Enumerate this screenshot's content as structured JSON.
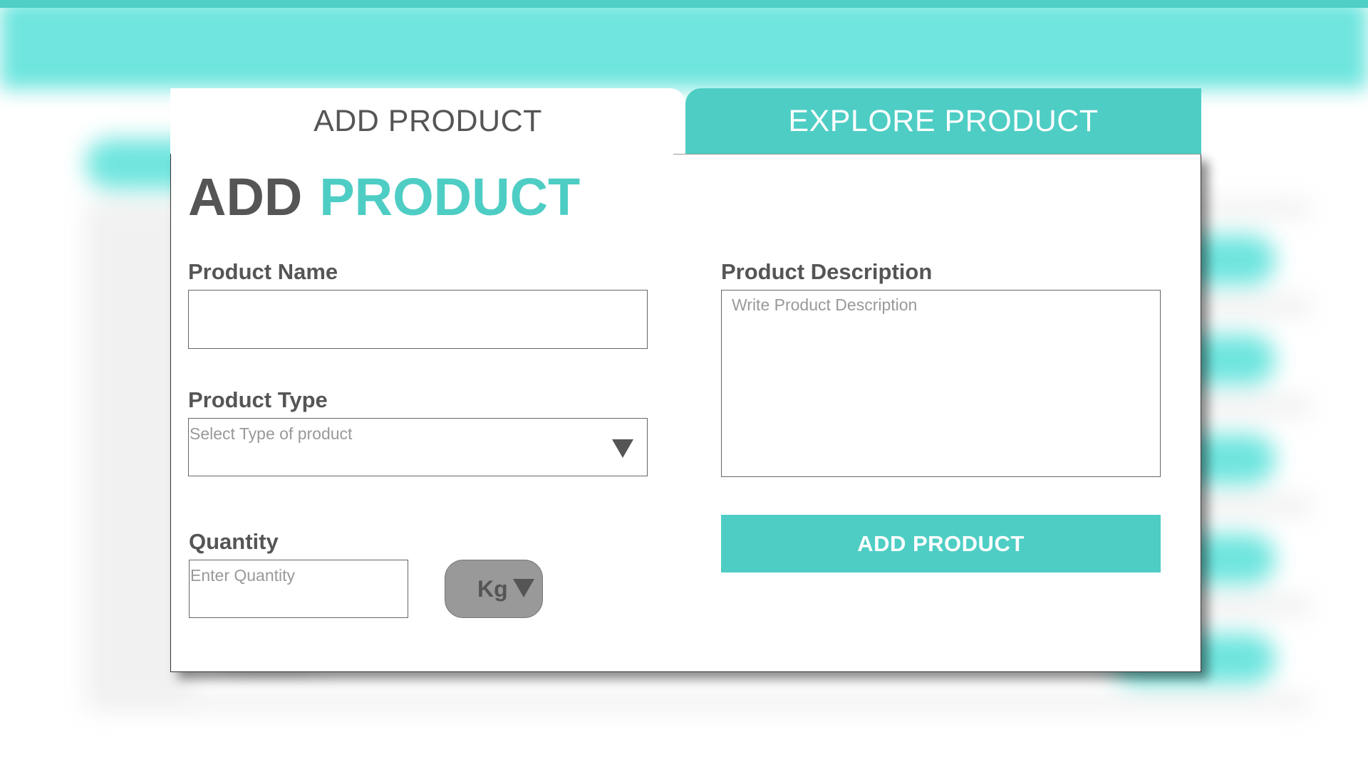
{
  "tabs": {
    "add": "ADD PRODUCT",
    "explore": "EXPLORE PRODUCT",
    "active": "add"
  },
  "title": {
    "word1": "ADD",
    "word2": "PRODUCT"
  },
  "form": {
    "product_name": {
      "label": "Product Name",
      "value": "",
      "placeholder": ""
    },
    "product_type": {
      "label": "Product Type",
      "placeholder": "Select Type of product"
    },
    "quantity": {
      "label": "Quantity",
      "placeholder": "Enter Quantity",
      "unit": "Kg"
    },
    "description": {
      "label": "Product Description",
      "placeholder": "Write Product Description"
    },
    "submit_label": "ADD PRODUCT"
  },
  "icons": {
    "type_dropdown": "chevron-down-icon",
    "unit_dropdown": "chevron-down-icon"
  },
  "colors": {
    "accent": "#4ecdc4",
    "header_bg": "#6ee5de",
    "text_dark": "#555555",
    "unit_pill": "#999999"
  }
}
